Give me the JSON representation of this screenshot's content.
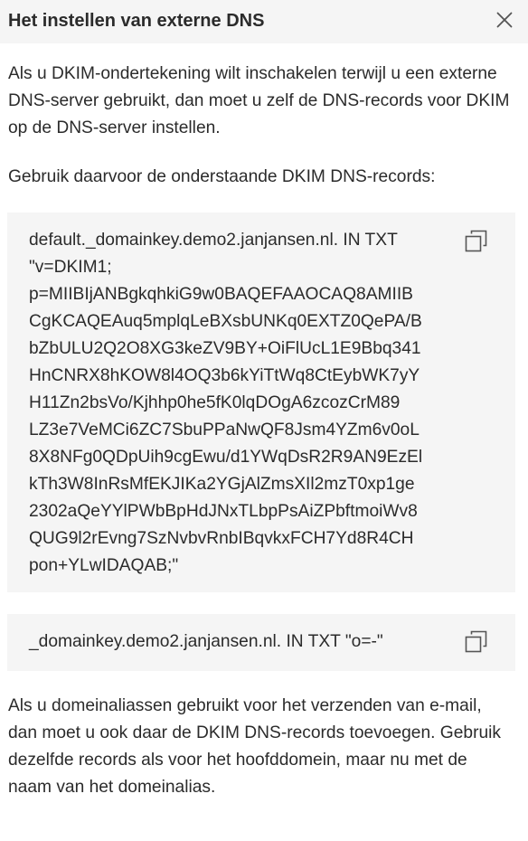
{
  "dialog": {
    "title": "Het instellen van externe DNS",
    "close_icon": "close-icon"
  },
  "content": {
    "intro": "Als u DKIM-ondertekening wilt inschakelen terwijl u een externe DNS-server gebruikt, dan moet u zelf de DNS-records voor DKIM op de DNS-server instellen.",
    "use_records": "Gebruik daarvoor de onderstaande DKIM DNS-records:",
    "record1": "default._domainkey.demo2.janjansen.nl. IN TXT\n\"v=DKIM1;\np=MIIBIjANBgkqhkiG9w0BAQEFAAOCAQ8AMIIB\nCgKCAQEAuq5mplqLeBXsbUNKq0EXTZ0QePA/B\nbZbULU2Q2O8XG3keZV9BY+OiFlUcL1E9Bbq341\nHnCNRX8hKOW8l4OQ3b6kYiTtWq8CtEybWK7yY\nH11Zn2bsVo/Kjhhp0he5fK0lqDOgA6zcozCrM89\nLZ3e7VeMCi6ZC7SbuPPaNwQF8Jsm4YZm6v0oL\n8X8NFg0QDpUih9cgEwu/d1YWqDsR2R9AN9EzEl\nkTh3W8InRsMfEKJIKa2YGjAlZmsXIl2mzT0xp1ge\n2302aQeYYlPWbBpHdJNxTLbpPsAiZPbftmoiWv8\nQUG9l2rEvng7SzNvbvRnbIBqvkxFCH7Yd8R4CH\npon+YLwIDAQAB;\"",
    "record2": "_domainkey.demo2.janjansen.nl. IN TXT \"o=-\"",
    "copy_icon": "copy-icon",
    "aliases": "Als u domeinaliassen gebruikt voor het verzenden van e-mail, dan moet u ook daar de DKIM DNS-records toevoegen. Gebruik dezelfde records als voor het hoofddomein, maar nu met de naam van het domeinalias."
  },
  "colors": {
    "header_bg": "#f5f5f5",
    "code_bg": "#f5f5f5",
    "text": "#2b2b2b",
    "icon": "#555555"
  }
}
